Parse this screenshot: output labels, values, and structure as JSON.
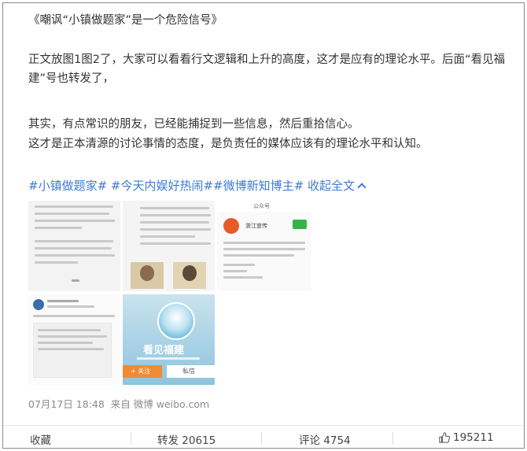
{
  "post": {
    "title": "《嘲讽“小镇做题家”是一个危险信号》",
    "para1": "正文放图1图2了，大家可以看看行文逻辑和上升的高度，这才是应有的理论水平。后面“看见福建”号也转发了，",
    "para2": "其实，有点常识的朋友，已经能捕捉到一些信息，然后重拾信心。",
    "para3": "这才是正本清源的讨论事情的态度，是负责任的媒体应该有的理论水平和认知。",
    "tags": [
      "#小镇做题家#",
      "#今天内娱好热闹##微博新知博主#",
      "收起全文"
    ]
  },
  "images": {
    "img3_header": "公众号",
    "img3_name": "浙江宣传",
    "img5_name": "看见福建",
    "img5_follow": "+ 关注",
    "img5_message": "私信"
  },
  "meta": {
    "time": "07月17日 18:48",
    "source_prefix": "来自",
    "source": "微博 weibo.com"
  },
  "actions": {
    "favorite": "收藏",
    "repost": "转发 20615",
    "comment": "评论 4754",
    "like": "195211"
  },
  "colors": {
    "link": "#3d7bd4",
    "text": "#333333",
    "meta": "#8a8a8a"
  }
}
